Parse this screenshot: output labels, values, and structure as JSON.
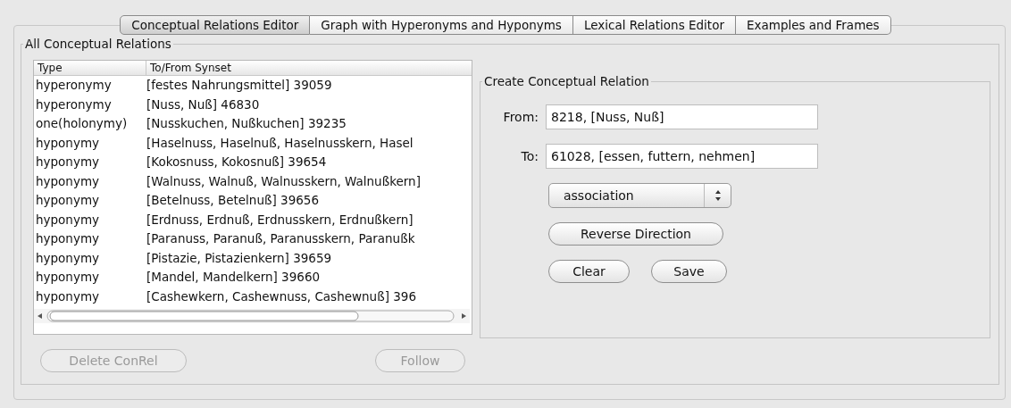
{
  "tabs": [
    {
      "label": "Conceptual Relations Editor",
      "selected": true
    },
    {
      "label": "Graph with Hyperonyms and Hyponyms",
      "selected": false
    },
    {
      "label": "Lexical Relations Editor",
      "selected": false
    },
    {
      "label": "Examples and Frames",
      "selected": false
    }
  ],
  "relations_panel": {
    "title": "All Conceptual Relations",
    "table": {
      "columns": [
        "Type",
        "To/From Synset"
      ],
      "rows": [
        [
          "hyperonymy",
          "[festes Nahrungsmittel] 39059"
        ],
        [
          "hyperonymy",
          "[Nuss, Nuß] 46830"
        ],
        [
          "one(holonymy)",
          "[Nusskuchen, Nußkuchen] 39235"
        ],
        [
          "hyponymy",
          "[Haselnuss, Haselnuß, Haselnusskern, Hasel"
        ],
        [
          "hyponymy",
          "[Kokosnuss, Kokosnuß] 39654"
        ],
        [
          "hyponymy",
          "[Walnuss, Walnuß, Walnusskern, Walnußkern]"
        ],
        [
          "hyponymy",
          "[Betelnuss, Betelnuß] 39656"
        ],
        [
          "hyponymy",
          "[Erdnuss, Erdnuß, Erdnusskern, Erdnußkern]"
        ],
        [
          "hyponymy",
          "[Paranuss, Paranuß, Paranusskern, Paranußk"
        ],
        [
          "hyponymy",
          "[Pistazie, Pistazienkern] 39659"
        ],
        [
          "hyponymy",
          "[Mandel, Mandelkern] 39660"
        ],
        [
          "hyponymy",
          "[Cashewkern, Cashewnuss, Cashewnuß] 396"
        ]
      ]
    },
    "buttons": [
      {
        "label": "Delete ConRel",
        "disabled": true
      },
      {
        "label": "Follow",
        "disabled": true
      }
    ]
  },
  "create_panel": {
    "title": "Create Conceptual Relation",
    "fields": [
      {
        "label": "From:",
        "value": "8218, [Nuss, Nuß]"
      },
      {
        "label": "To:",
        "value": "61028, [essen, futtern, nehmen]"
      }
    ],
    "relation_type": "association",
    "reverse_button": "Reverse Direction",
    "buttons": [
      "Clear",
      "Save"
    ]
  }
}
